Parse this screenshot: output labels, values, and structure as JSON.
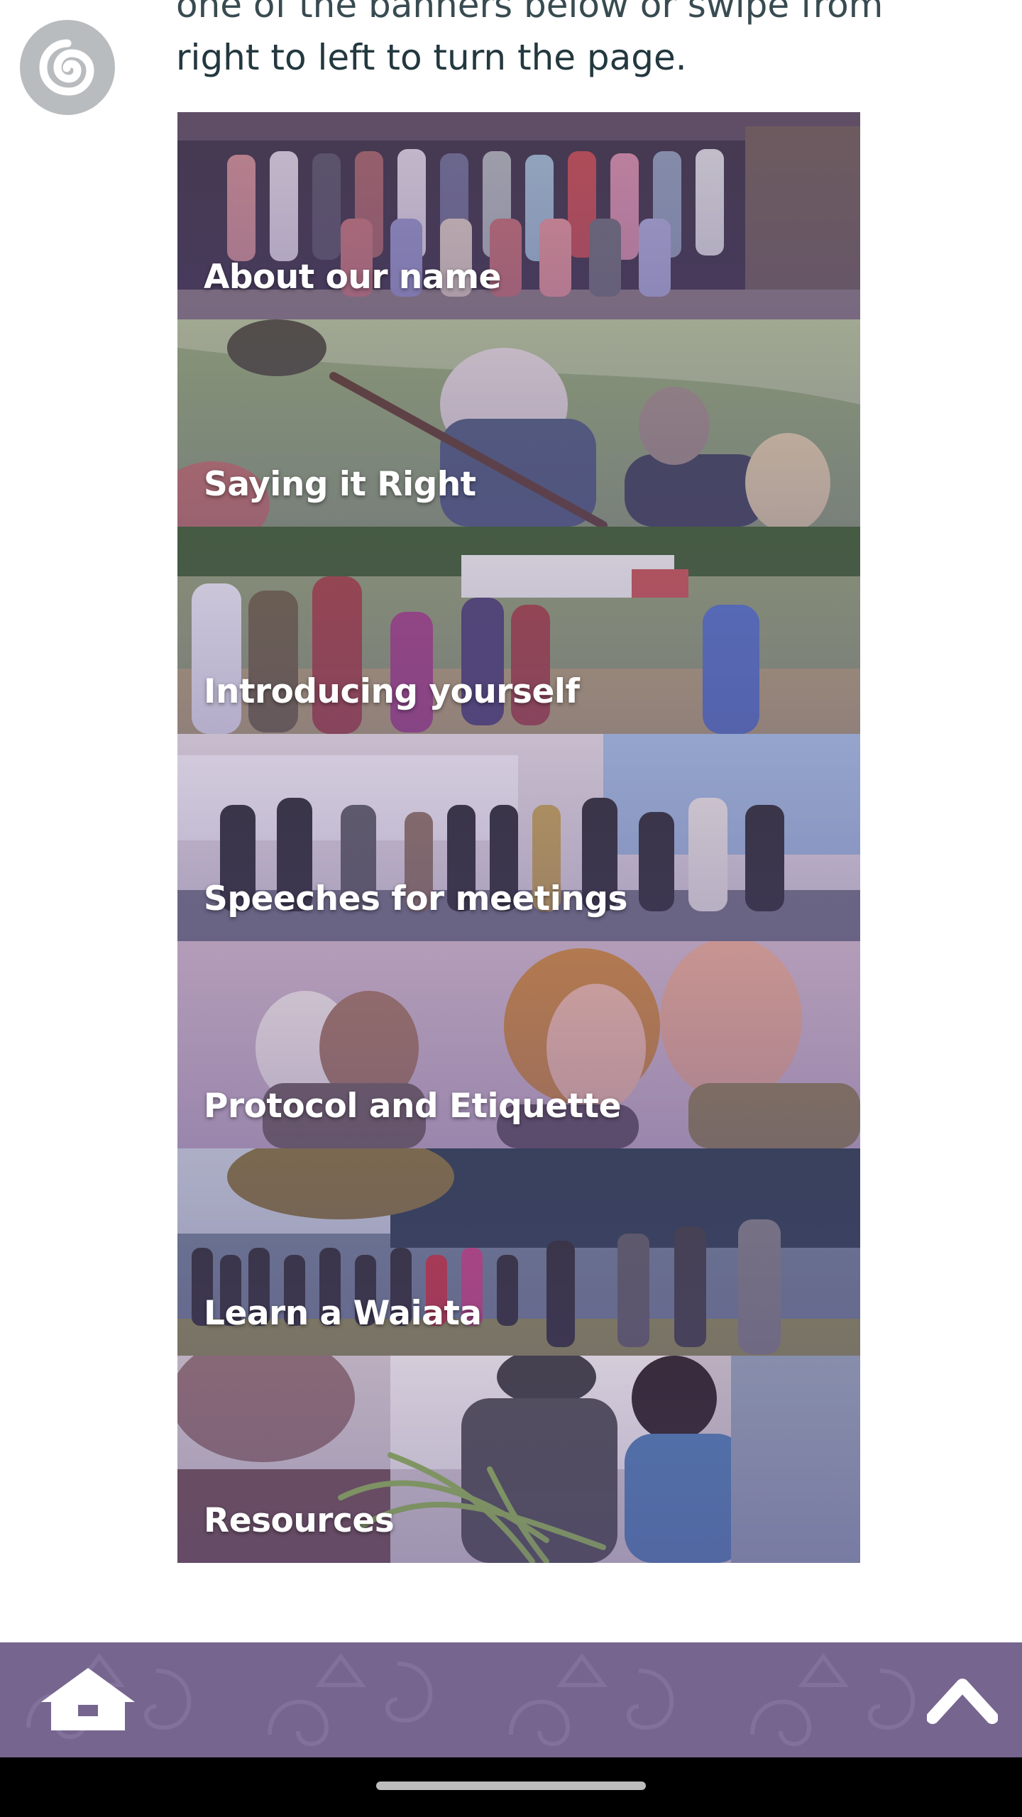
{
  "intro": {
    "line_partial": "one of the banners below or swipe from",
    "line2": "right to left to turn the page."
  },
  "icons": {
    "menu": "koru-icon",
    "home": "whare-home-icon",
    "up": "chevron-up-icon"
  },
  "banners": [
    {
      "label": "About our name"
    },
    {
      "label": "Saying it Right"
    },
    {
      "label": "Introducing yourself"
    },
    {
      "label": "Speeches for meetings"
    },
    {
      "label": "Protocol and Etiquette"
    },
    {
      "label": "Learn a Waiata"
    },
    {
      "label": "Resources"
    }
  ],
  "colors": {
    "bar": "#76658f",
    "menu_button": "#b9bcbf",
    "text": "#23383f"
  }
}
